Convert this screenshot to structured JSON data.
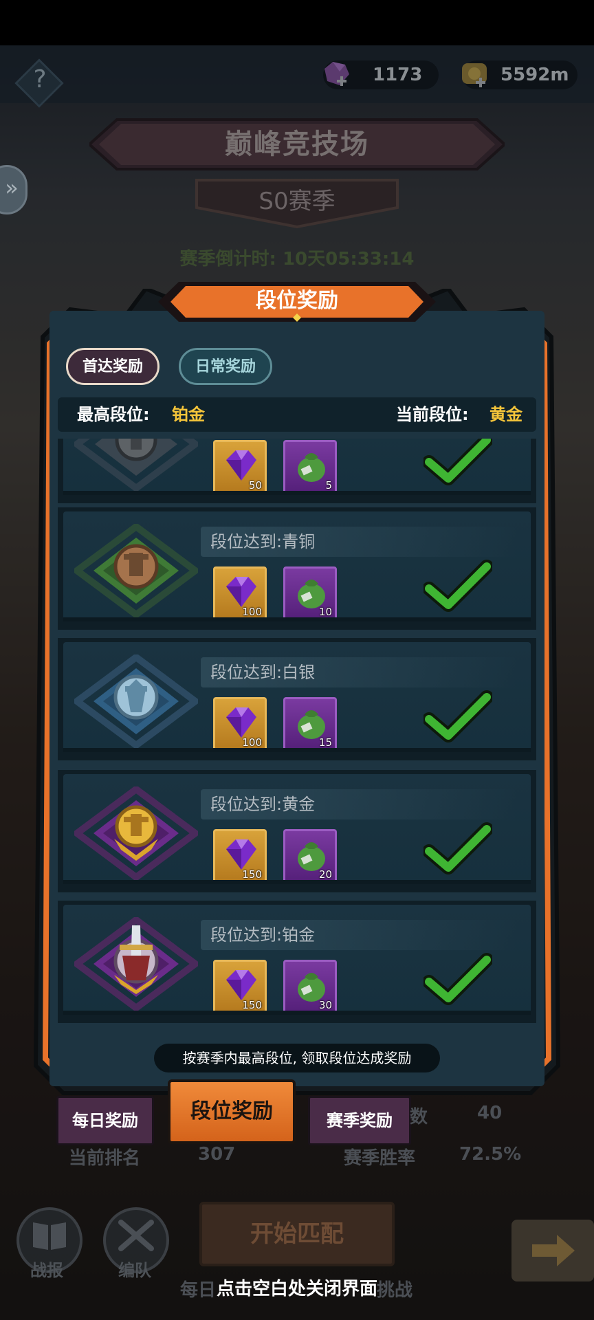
{
  "topbar": {
    "gems": "1173",
    "gold": "5592m",
    "menu_glyph": "?"
  },
  "arena": {
    "title": "巅峰竞技场",
    "season": "S0赛季",
    "countdown": "赛季倒计时: 10天05:33:14"
  },
  "panel": {
    "title": "段位奖励",
    "tabs": [
      {
        "label": "首达奖励",
        "active": true
      },
      {
        "label": "日常奖励",
        "active": false
      }
    ],
    "highest_rank_label": "最高段位:",
    "highest_rank_value": "铂金",
    "current_rank_label": "当前段位:",
    "current_rank_value": "黄金",
    "tiers": [
      {
        "label": "",
        "emblem": "iron-emblem-icon",
        "gems": "50",
        "bags": "5",
        "claimed": true
      },
      {
        "label": "段位达到:青铜",
        "emblem": "bronze-emblem-icon",
        "gems": "100",
        "bags": "10",
        "claimed": true
      },
      {
        "label": "段位达到:白银",
        "emblem": "silver-emblem-icon",
        "gems": "100",
        "bags": "15",
        "claimed": true
      },
      {
        "label": "段位达到:黄金",
        "emblem": "gold-emblem-icon",
        "gems": "150",
        "bags": "20",
        "claimed": true
      },
      {
        "label": "段位达到:铂金",
        "emblem": "platinum-emblem-icon",
        "gems": "150",
        "bags": "30",
        "claimed": true
      }
    ],
    "hint": "按赛季内最高段位, 领取段位达成奖励"
  },
  "bottom_tabs": {
    "daily": "每日奖励",
    "rank": "段位奖励",
    "season": "赛季奖励"
  },
  "background_stats": {
    "rank_label": "当前排名",
    "rank_value": "307",
    "winrate_label": "赛季胜率",
    "winrate_value": "72.5%",
    "count_suffix": "数",
    "count_value": "40"
  },
  "bottom_bar": {
    "battle_report": "战报",
    "team": "编队",
    "match": "开始匹配",
    "daily_challenge_left": "每日",
    "daily_challenge_right": "挑战"
  },
  "close_hint": "点击空白处关闭界面",
  "colors": {
    "accent_orange": "#e8722a",
    "panel_bg": "#1d3441",
    "rank_gold": "#f5c53a",
    "check_green": "#3fb533"
  }
}
